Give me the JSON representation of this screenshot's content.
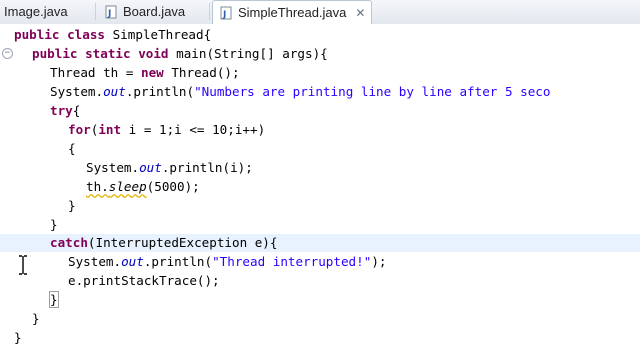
{
  "tabs": [
    {
      "label": "Image.java",
      "active": false
    },
    {
      "label": "Board.java",
      "active": false
    },
    {
      "label": "SimpleThread.java",
      "active": true
    }
  ],
  "code": {
    "l1_a": "public",
    "l1_b": " ",
    "l1_c": "class",
    "l1_d": " SimpleThread{",
    "l2_a": "public",
    "l2_b": "static",
    "l2_c": "void",
    "l2_d": " main(String[] args){",
    "l3_a": "Thread th = ",
    "l3_b": "new",
    "l3_c": " Thread();",
    "l4_a": "System.",
    "l4_b": "out",
    "l4_c": ".println(",
    "l4_d": "\"Numbers are printing line by line after 5 seco",
    "l5_a": "try",
    "l5_b": "{",
    "l6_a": "for",
    "l6_b": "(",
    "l6_c": "int",
    "l6_d": " i = 1;i <= 10;i++)",
    "l7": "{",
    "l8_a": "System.",
    "l8_b": "out",
    "l8_c": ".println(i);",
    "l9_a": "th.",
    "l9_b": "sleep",
    "l9_c": "(5000);",
    "l10": "}",
    "l11": "}",
    "l12_a": "catch",
    "l12_b": "(InterruptedException e){",
    "l13_a": "System.",
    "l13_b": "out",
    "l13_c": ".println(",
    "l13_d": "\"Thread interrupted!\"",
    "l13_e": ");",
    "l14": "e.printStackTrace();",
    "l15": "}",
    "l16": "}",
    "l17": "}"
  },
  "colors": {
    "keyword": "#7f0055",
    "string": "#2a00ff",
    "static_field": "#0000c0",
    "current_line": "#e8f2fe"
  }
}
